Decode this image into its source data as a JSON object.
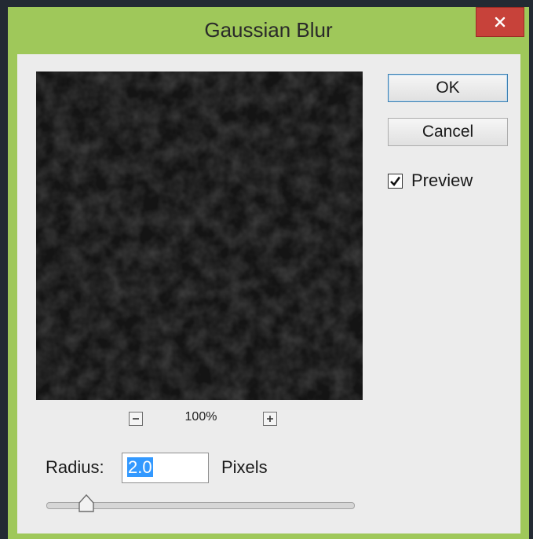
{
  "dialog": {
    "title": "Gaussian Blur",
    "close_icon": "close-icon"
  },
  "preview": {
    "zoom_level": "100%",
    "zoom_out_icon": "zoom-out-icon",
    "zoom_in_icon": "zoom-in-icon"
  },
  "buttons": {
    "ok_label": "OK",
    "cancel_label": "Cancel"
  },
  "preview_checkbox": {
    "label": "Preview",
    "checked": true
  },
  "radius": {
    "label": "Radius:",
    "value": "2.0",
    "unit": "Pixels",
    "slider_level": 0.1
  },
  "colors": {
    "window_frame": "#9fc85a",
    "close_button": "#c7423a",
    "selection": "#3399ff",
    "dialog_bg": "#ececec"
  }
}
